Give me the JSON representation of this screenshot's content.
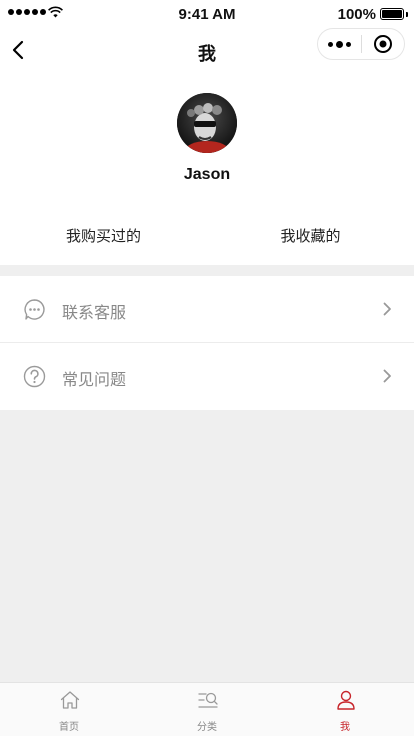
{
  "status_bar": {
    "time": "9:41 AM",
    "battery": "100%"
  },
  "nav": {
    "title": "我"
  },
  "profile": {
    "username": "Jason"
  },
  "tabs": [
    {
      "label": "我购买过的"
    },
    {
      "label": "我收藏的"
    }
  ],
  "menu": [
    {
      "label": "联系客服",
      "icon": "chat-bubble-icon"
    },
    {
      "label": "常见问题",
      "icon": "question-icon"
    }
  ],
  "tab_bar": {
    "active_color": "#c7252b",
    "items": [
      {
        "label": "首页",
        "icon": "home-icon"
      },
      {
        "label": "分类",
        "icon": "category-search-icon"
      },
      {
        "label": "我",
        "icon": "user-icon",
        "active": true
      }
    ]
  }
}
